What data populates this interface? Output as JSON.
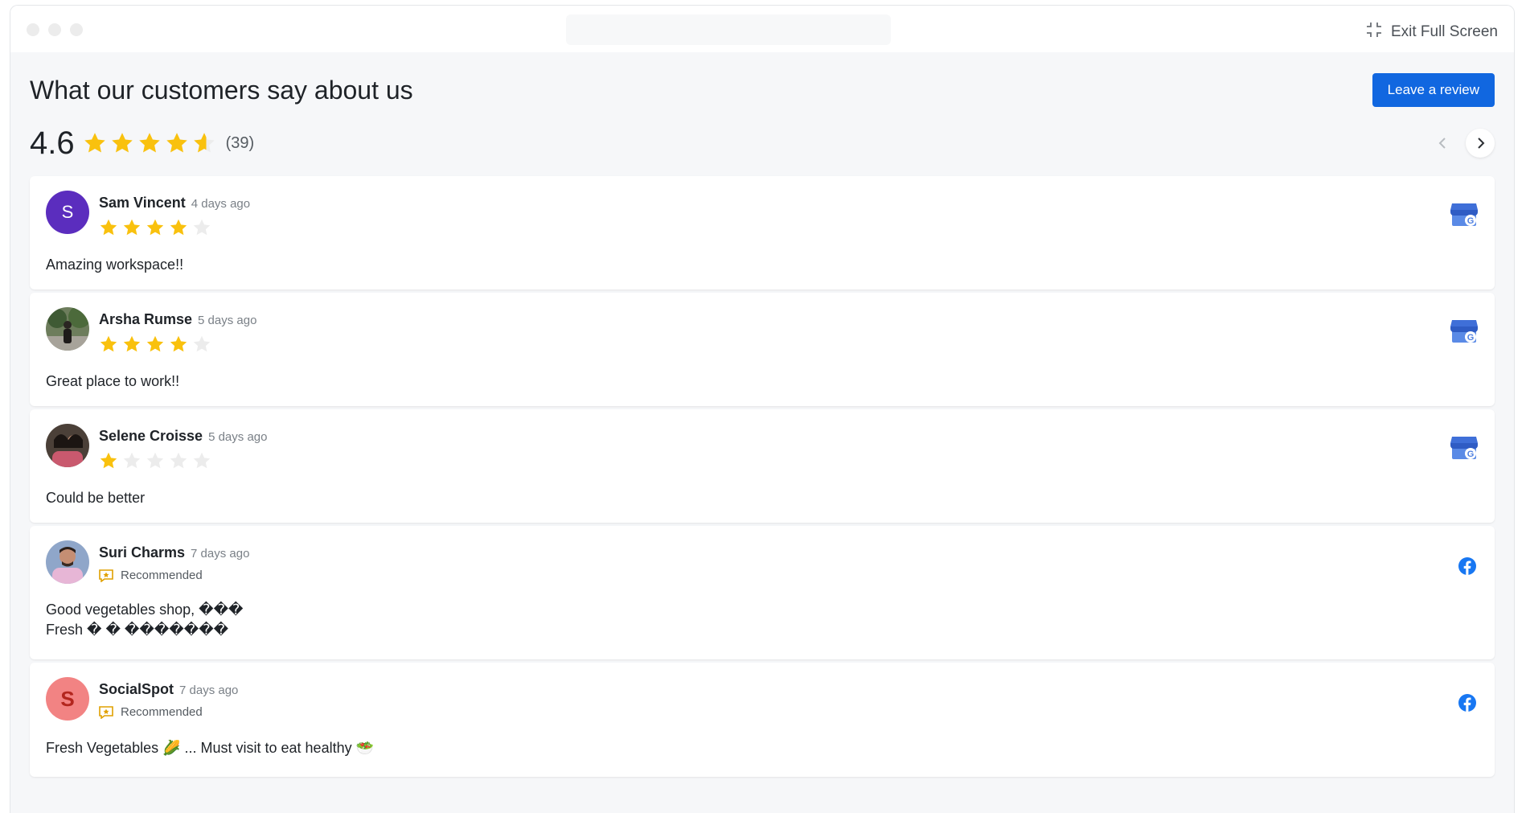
{
  "window": {
    "exit_label": "Exit Full Screen"
  },
  "header": {
    "title": "What our customers say about us",
    "leave_review_label": "Leave a review"
  },
  "summary": {
    "average": "4.6",
    "count": "(39)",
    "rating_value": 4.6,
    "max_rating": 5
  },
  "colors": {
    "star": "#f9c10e",
    "star_empty": "#ececec",
    "primary": "#1167e0",
    "facebook": "#1877f2",
    "google_blue": "#4d7ee0"
  },
  "reviews": [
    {
      "name": "Sam Vincent",
      "ago": "4 days ago",
      "rating": 4,
      "text": "Amazing workspace!!",
      "source_icon": "google-business-icon",
      "avatar": {
        "type": "letter",
        "letter": "S",
        "color": "#5b2dbe"
      }
    },
    {
      "name": "Arsha Rumse",
      "ago": "5 days ago",
      "rating": 4,
      "text": "Great place to work!!",
      "source_icon": "google-business-icon",
      "avatar": {
        "type": "photo"
      }
    },
    {
      "name": "Selene Croisse",
      "ago": "5 days ago",
      "rating": 1,
      "text": "Could be better",
      "source_icon": "google-business-icon",
      "avatar": {
        "type": "photo"
      }
    },
    {
      "name": "Suri Charms",
      "ago": "7 days ago",
      "recommended": "Recommended",
      "text": "Good vegetables shop, ���",
      "text2": "Fresh � � �������",
      "source_icon": "facebook-icon",
      "avatar": {
        "type": "photo"
      }
    },
    {
      "name": "SocialSpot",
      "ago": "7 days ago",
      "recommended": "Recommended",
      "text": "Fresh Vegetables 🌽 ... Must visit to eat healthy 🥗",
      "source_icon": "facebook-icon",
      "avatar": {
        "type": "letter",
        "letter": "S",
        "color": "#f28383",
        "text_color": "#b3261e"
      }
    }
  ]
}
